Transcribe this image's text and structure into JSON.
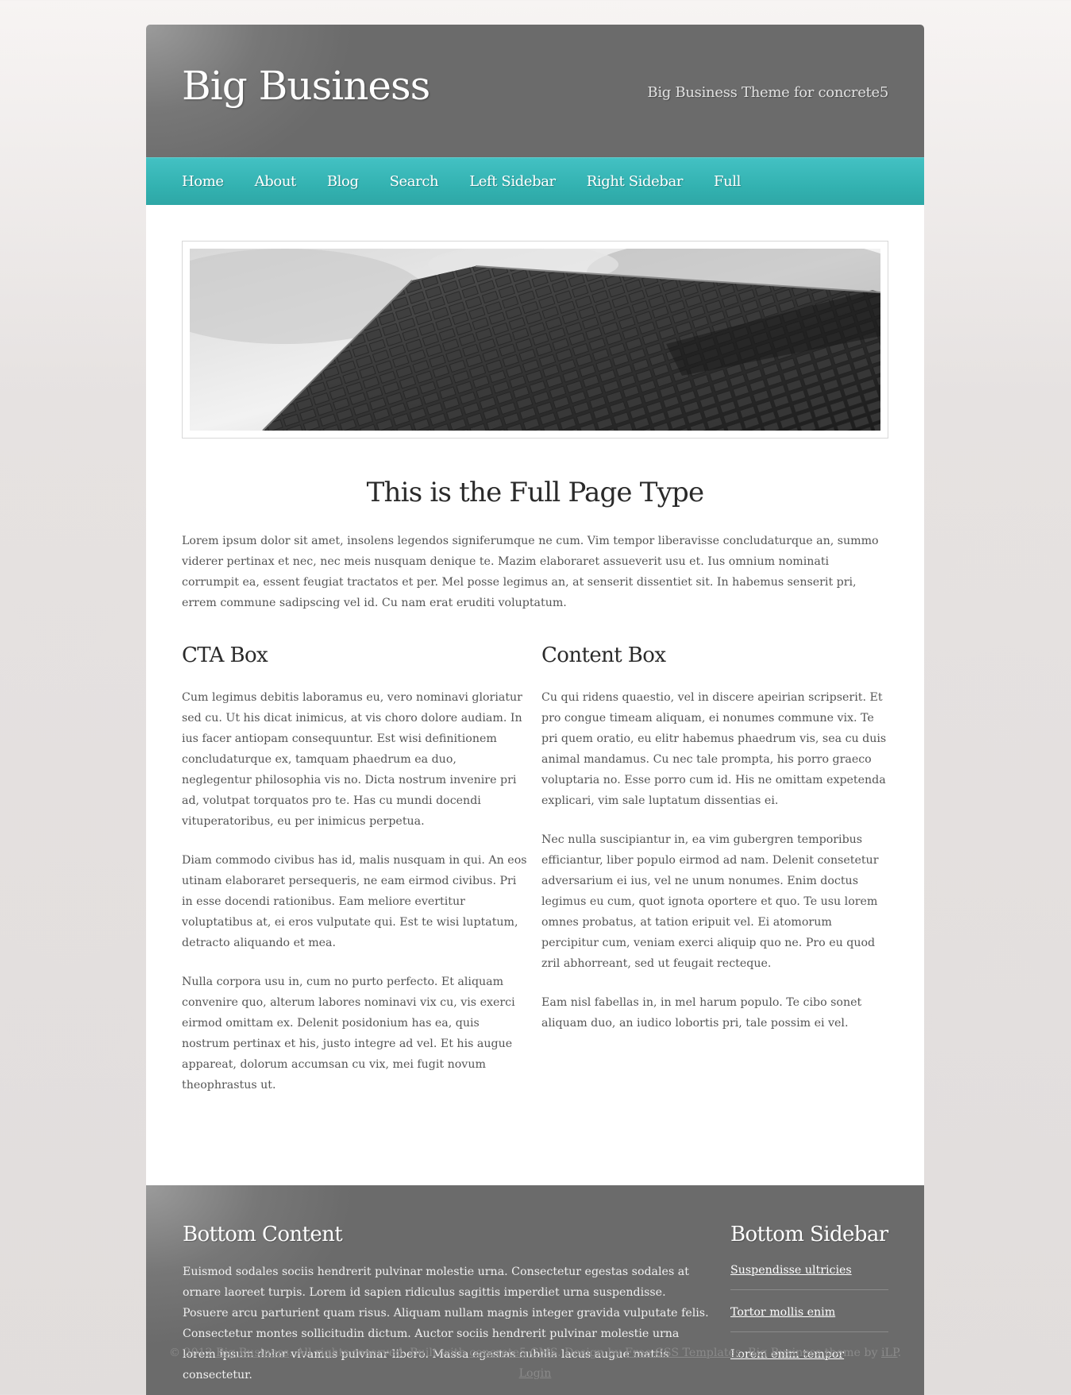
{
  "header": {
    "site_title": "Big Business",
    "tagline": "Big Business Theme for concrete5"
  },
  "nav": {
    "items": [
      "Home",
      "About",
      "Blog",
      "Search",
      "Left Sidebar",
      "Right Sidebar",
      "Full"
    ]
  },
  "main": {
    "heading": "This is the Full Page Type",
    "intro": "Lorem ipsum dolor sit amet, insolens legendos signiferumque ne cum. Vim tempor liberavisse concludaturque an, summo viderer pertinax et nec, nec meis nusquam denique te. Mazim elaboraret assueverit usu et. Ius omnium nominati corrumpit ea, essent feugiat tractatos et per. Mel posse legimus an, at senserit dissentiet sit. In habemus senserit pri, errem commune sadipscing vel id. Cu nam erat eruditi voluptatum.",
    "cta": {
      "title": "CTA Box",
      "paragraphs": [
        "Cum legimus debitis laboramus eu, vero nominavi gloriatur sed cu. Ut his dicat inimicus, at vis choro dolore audiam. In ius facer antiopam consequuntur. Est wisi definitionem concludaturque ex, tamquam phaedrum ea duo, neglegentur philosophia vis no. Dicta nostrum invenire pri ad, volutpat torquatos pro te. Has cu mundi docendi vituperatoribus, eu per inimicus perpetua.",
        "Diam commodo civibus has id, malis nusquam in qui. An eos utinam elaboraret persequeris, ne eam eirmod civibus. Pri in esse docendi rationibus. Eam meliore evertitur voluptatibus at, ei eros vulputate qui. Est te wisi luptatum, detracto aliquando et mea.",
        "Nulla corpora usu in, cum no purto perfecto. Et aliquam convenire quo, alterum labores nominavi vix cu, vis exerci eirmod omittam ex. Delenit posidonium has ea, quis nostrum pertinax et his, justo integre ad vel. Et his augue appareat, dolorum accumsan cu vix, mei fugit novum theophrastus ut."
      ]
    },
    "content": {
      "title": "Content Box",
      "paragraphs": [
        "Cu qui ridens quaestio, vel in discere apeirian scripserit. Et pro congue timeam aliquam, ei nonumes commune vix. Te pri quem oratio, eu elitr habemus phaedrum vis, sea cu duis animal mandamus. Cu nec tale prompta, his porro graeco voluptaria no. Esse porro cum id. His ne omittam expetenda explicari, vim sale luptatum dissentias ei.",
        "Nec nulla suscipiantur in, ea vim gubergren temporibus efficiantur, liber populo eirmod ad nam. Delenit consetetur adversarium ei ius, vel ne unum nonumes. Enim doctus legimus eu cum, quot ignota oportere et quo. Te usu lorem omnes probatus, at tation eripuit vel. Ei atomorum percipitur cum, veniam exerci aliquip quo ne. Pro eu quod zril abhorreant, sed ut feugait recteque.",
        "Eam nisl fabellas in, in mel harum populo. Te cibo sonet aliquam duo, an iudico lobortis pri, tale possim ei vel."
      ]
    }
  },
  "bottom": {
    "content_title": "Bottom Content",
    "content_text": "Euismod sodales sociis hendrerit pulvinar molestie urna. Consectetur egestas sodales at ornare laoreet turpis. Lorem id sapien ridiculus sagittis imperdiet urna suspendisse. Posuere arcu parturient quam risus. Aliquam nullam magnis integer gravida vulputate felis. Consectetur montes sollicitudin dictum. Auctor sociis hendrerit pulvinar molestie urna lorem ipsum dolor vivamus pulvinar libero. Massa egestas cubilia lacus augue mattis consectetur.",
    "sidebar_title": "Bottom Sidebar",
    "sidebar_links": [
      "Suspendisse ultricies",
      "Tortor mollis enim",
      "Lorem enim tempor"
    ]
  },
  "footer": {
    "copy_prefix": "© 2012 ",
    "site_link": "Big Business",
    "text1": ". All rights reserved. Built with ",
    "cms_link": "concrete5 CMS",
    "text2": ". Design by ",
    "design_link": "Free CSS Templates",
    "text3": ". Big Business theme by ",
    "author_link": "iLP",
    "text4": ".",
    "login_link": "Login"
  },
  "colors": {
    "nav_teal": "#35b3b3",
    "header_gray": "#6b6b6b",
    "page_bg": "#e6e2e1"
  }
}
